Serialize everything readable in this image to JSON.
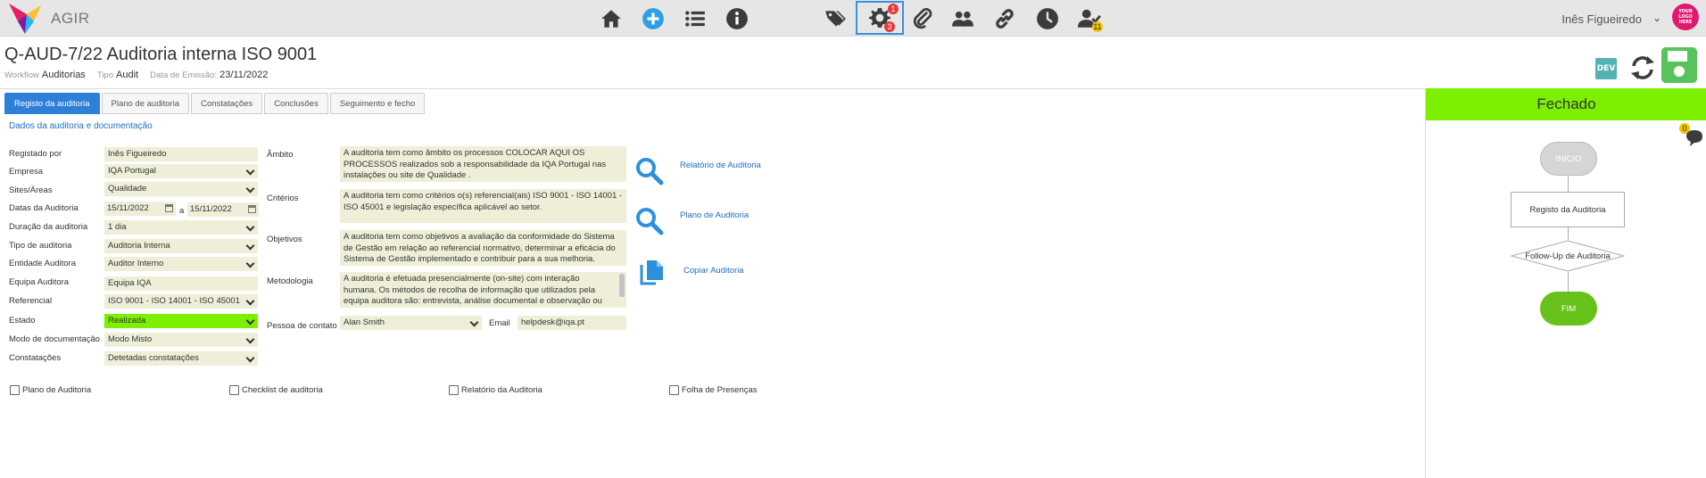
{
  "app": {
    "brand": "AGIR"
  },
  "nav": {
    "badges": {
      "settings_top": "1",
      "settings_bottom": "3",
      "tasks": "11"
    }
  },
  "user": {
    "name": "Inês Figueiredo",
    "logo_text": "YOUR LOGO HERE"
  },
  "header": {
    "title": "Q-AUD-7/22 Auditoria interna ISO 9001",
    "workflow_label": "Workflow",
    "workflow_value": "Auditorias",
    "tipo_label": "Tipo",
    "tipo_value": "Audit",
    "data_label": "Data de Emissão:",
    "data_value": "23/11/2022",
    "dev": "DEV"
  },
  "tabs": [
    {
      "label": "Registo da auditoria"
    },
    {
      "label": "Plano de auditoria"
    },
    {
      "label": "Constatações"
    },
    {
      "label": "Conclusões"
    },
    {
      "label": "Seguimento e fecho"
    }
  ],
  "section_link": "Dados da auditoria e documentação",
  "form": {
    "registado_por": {
      "label": "Registado por",
      "value": "Inês Figueiredo"
    },
    "empresa": {
      "label": "Empresa",
      "value": "IQA Portugal"
    },
    "sites": {
      "label": "Sites/Áreas",
      "value": "Qualidade"
    },
    "datas": {
      "label": "Datas da Auditoria",
      "from": "15/11/2022",
      "sep": "a",
      "to": "15/11/2022"
    },
    "duracao": {
      "label": "Duração da auditoria",
      "value": "1 dia"
    },
    "tipo": {
      "label": "Tipo de auditoria",
      "value": "Auditoria Interna"
    },
    "entidade": {
      "label": "Entidade Auditora",
      "value": "Auditor Interno"
    },
    "equipa": {
      "label": "Equipa Auditora",
      "value": "Equipa IQA"
    },
    "referencial": {
      "label": "Referencial",
      "value": "ISO 9001 - ISO 14001 - ISO 45001"
    },
    "estado": {
      "label": "Estado",
      "value": "Realizada"
    },
    "modo": {
      "label": "Modo de documentação",
      "value": "Modo Misto"
    },
    "constatacoes": {
      "label": "Constatações",
      "value": "Detetadas constatações"
    }
  },
  "details": {
    "ambito": {
      "label": "Âmbito",
      "text": "A auditoria tem como âmbito os processos COLOCAR AQUI OS PROCESSOS realizados sob a responsabilidade da IQA Portugal nas instalações ou site de Qualidade ."
    },
    "criterios": {
      "label": "Critérios",
      "text": "A auditoria tem como critérios o(s) referencial(ais) ISO 9001 - ISO 14001 - ISO 45001 e legislação específica aplicável ao setor."
    },
    "objetivos": {
      "label": "Objetivos",
      "text": "A auditoria tem como objetivos a avaliação da conformidade do Sistema de Gestão em relação ao referencial normativo, determinar a eficácia do Sistema de Gestão implementado e contribuir para a sua melhoria."
    },
    "metodologia": {
      "label": "Metodologia",
      "text": "A auditoria é efetuada presencialmente (on-site) com interação humana. Os métodos de recolha de informação que  utilizados pela equipa auditora são: entrevista, análise documental e observação ou"
    },
    "contacto": {
      "label": "Pessoa de contato",
      "value": "Alan Smith",
      "email_label": "Email",
      "email_value": "helpdesk@iqa.pt"
    }
  },
  "actions": {
    "relatorio": "Relatório de Auditoria",
    "plano": "Plano de Auditoria",
    "copiar": "Copiar Auditoria"
  },
  "checkboxes": [
    {
      "label": "Plano de Auditoria"
    },
    {
      "label": "Checklist de auditoria"
    },
    {
      "label": "Relatório da Auditoria"
    },
    {
      "label": "Folha de Presenças"
    }
  ],
  "workflow": {
    "status": "Fechado",
    "comments": "0",
    "start": "INÍCIO",
    "step1": "Registo da Auditoria",
    "step2": "Follow-Up de Auditoria",
    "end": "FIM"
  },
  "colors": {
    "accent": "#2d7fd8",
    "status_green": "#7cf000",
    "field_bg": "#efefd9",
    "save_green": "#58c25c",
    "icon_dark": "#3c3c3c",
    "link_blue": "#1e6fc9"
  }
}
